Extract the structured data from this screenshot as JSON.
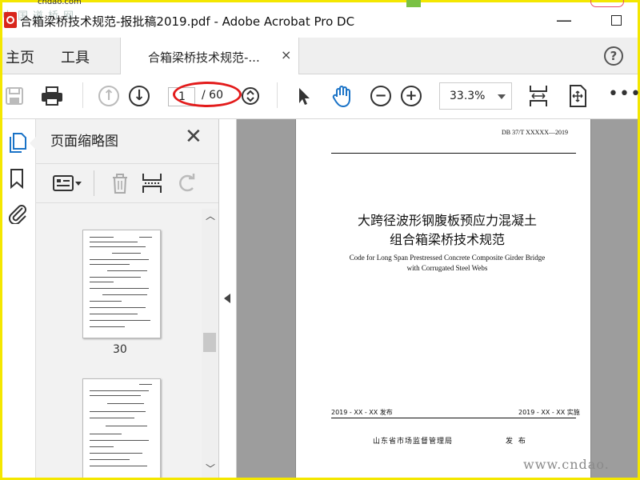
{
  "window": {
    "title": "合箱梁桥技术规范-报批稿2019.pdf - Adobe Acrobat Pro DC",
    "overlay_url": "cndao.com",
    "overlay_site": "中国道桥网"
  },
  "nav": {
    "home": "主页",
    "tools": "工具"
  },
  "tab": {
    "label": "合箱梁桥技术规范-...",
    "close": "×"
  },
  "help": "?",
  "toolbar": {
    "current_page": "1",
    "total_pages": "/ 60",
    "zoom": "33.3%",
    "more": "•••"
  },
  "panel": {
    "title": "页面缩略图",
    "close": "✕",
    "thumbnail_label": "30"
  },
  "document": {
    "standard_code": "DB 37/T XXXXX—2019",
    "title_line1": "大跨径波形钢腹板预应力混凝土",
    "title_line2": "组合箱梁桥技术规范",
    "en_line1": "Code for Long Span Prestressed Concrete Composite Girder Bridge",
    "en_line2": "with Corrugated Steel Webs",
    "issue_date": "2019 - XX - XX 发布",
    "effective_date": "2019 - XX - XX 实施",
    "issuer": "山东省市场监督管理局",
    "publish": "发 布"
  },
  "watermark": "www.cndao."
}
